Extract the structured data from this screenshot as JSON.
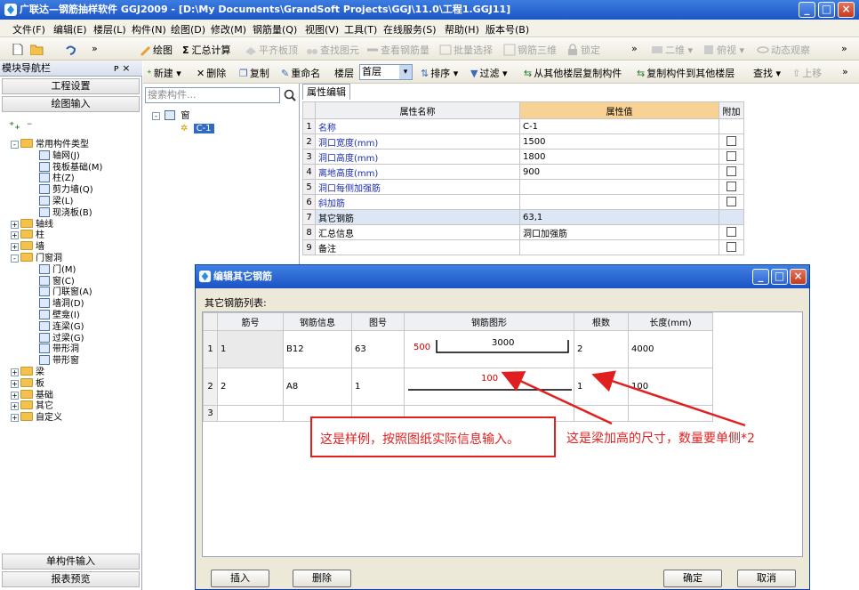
{
  "window": {
    "title": "广联达—钢筋抽样软件 GGJ2009 - [D:\\My Documents\\GrandSoft Projects\\GGJ\\11.0\\工程1.GGJ11]",
    "min_label": "_",
    "max_label": "□",
    "close_label": "×"
  },
  "menu": [
    "文件(F)",
    "编辑(E)",
    "楼层(L)",
    "构件(N)",
    "绘图(D)",
    "修改(M)",
    "钢筋量(Q)",
    "视图(V)",
    "工具(T)",
    "在线服务(S)",
    "帮助(H)",
    "版本号(B)"
  ],
  "toolbar": {
    "draw": "绘图",
    "sum": "汇总计算",
    "flat_slab": "平齐板顶",
    "find": "查找图元",
    "view_rebar": "查看钢筋量",
    "batch_select": "批量选择",
    "rebar_3d": "钢筋三维",
    "lock": "锁定",
    "mode_2d": "二维",
    "top_view": "俯视",
    "dynamic_view": "动态观察",
    "more": "»"
  },
  "component_toolbar": {
    "new": "新建",
    "delete": "删除",
    "copy": "复制",
    "rename": "重命名",
    "floor_label": "楼层",
    "floor_value": "首层",
    "sort": "排序",
    "filter": "过滤",
    "copy_from_floor": "从其他楼层复制构件",
    "copy_to_floor": "复制构件到其他楼层",
    "find": "查找",
    "move_up": "上移",
    "more": "»"
  },
  "left_panel": {
    "header": "模块导航栏",
    "pin": "ᴘ ×",
    "project_settings": "工程设置",
    "draw_input": "绘图输入",
    "single_input": "单构件输入",
    "report_preview": "报表预览",
    "tree": [
      {
        "label": "常用构件类型",
        "level": 0,
        "sign": "-"
      },
      {
        "label": "轴网(J)",
        "level": 1
      },
      {
        "label": "筏板基础(M)",
        "level": 1
      },
      {
        "label": "柱(Z)",
        "level": 1
      },
      {
        "label": "剪力墙(Q)",
        "level": 1
      },
      {
        "label": "梁(L)",
        "level": 1
      },
      {
        "label": "现浇板(B)",
        "level": 1
      },
      {
        "label": "轴线",
        "level": 0,
        "sign": "+"
      },
      {
        "label": "柱",
        "level": 0,
        "sign": "+"
      },
      {
        "label": "墙",
        "level": 0,
        "sign": "+"
      },
      {
        "label": "门窗洞",
        "level": 0,
        "sign": "-"
      },
      {
        "label": "门(M)",
        "level": 1
      },
      {
        "label": "窗(C)",
        "level": 1
      },
      {
        "label": "门联窗(A)",
        "level": 1
      },
      {
        "label": "墙洞(D)",
        "level": 1
      },
      {
        "label": "壁龛(I)",
        "level": 1
      },
      {
        "label": "连梁(G)",
        "level": 1
      },
      {
        "label": "过梁(G)",
        "level": 1
      },
      {
        "label": "带形洞",
        "level": 1
      },
      {
        "label": "带形窗",
        "level": 1
      },
      {
        "label": "梁",
        "level": 0,
        "sign": "+"
      },
      {
        "label": "板",
        "level": 0,
        "sign": "+"
      },
      {
        "label": "基础",
        "level": 0,
        "sign": "+"
      },
      {
        "label": "其它",
        "level": 0,
        "sign": "+"
      },
      {
        "label": "自定义",
        "level": 0,
        "sign": "+"
      }
    ]
  },
  "component_list": {
    "search_placeholder": "搜索构件...",
    "root": "窗",
    "item": "C-1"
  },
  "property_editor": {
    "tab": "属性编辑",
    "headers": [
      "属性名称",
      "属性值",
      "附加"
    ],
    "rows": [
      {
        "n": "1",
        "name": "名称",
        "value": "C-1",
        "check": false
      },
      {
        "n": "2",
        "name": "洞口宽度(mm)",
        "value": "1500",
        "check": true
      },
      {
        "n": "3",
        "name": "洞口高度(mm)",
        "value": "1800",
        "check": true
      },
      {
        "n": "4",
        "name": "离地高度(mm)",
        "value": "900",
        "check": true
      },
      {
        "n": "5",
        "name": "洞口每侧加强筋",
        "value": "",
        "check": true
      },
      {
        "n": "6",
        "name": "斜加筋",
        "value": "",
        "check": true
      },
      {
        "n": "7",
        "name": "其它钢筋",
        "value": "63,1",
        "check": false
      },
      {
        "n": "8",
        "name": "汇总信息",
        "value": "洞口加强筋",
        "check": true
      },
      {
        "n": "9",
        "name": "备注",
        "value": "",
        "check": true
      }
    ]
  },
  "dialog": {
    "title": "编辑其它钢筋",
    "list_label": "其它钢筋列表:",
    "headers": [
      "筋号",
      "钢筋信息",
      "图号",
      "钢筋图形",
      "根数",
      "长度(mm)"
    ],
    "rows": [
      {
        "n": "1",
        "bar": "1",
        "info": "B12",
        "fig": "63",
        "shape_left": "500",
        "shape_mid": "3000",
        "count": "2",
        "length": "4000"
      },
      {
        "n": "2",
        "bar": "2",
        "info": "A8",
        "fig": "1",
        "shape_left": "",
        "shape_mid": "100",
        "count": "1",
        "length": "100"
      },
      {
        "n": "3",
        "bar": "",
        "info": "",
        "fig": "",
        "shape_left": "",
        "shape_mid": "",
        "count": "",
        "length": ""
      }
    ],
    "insert": "插入",
    "delete": "删除",
    "ok": "确定",
    "cancel": "取消"
  },
  "annotations": {
    "sample": "这是样例，按照图纸实际信息输入。",
    "beam": "这是梁加高的尺寸，数量要单侧*2",
    "color": "#e02020"
  }
}
